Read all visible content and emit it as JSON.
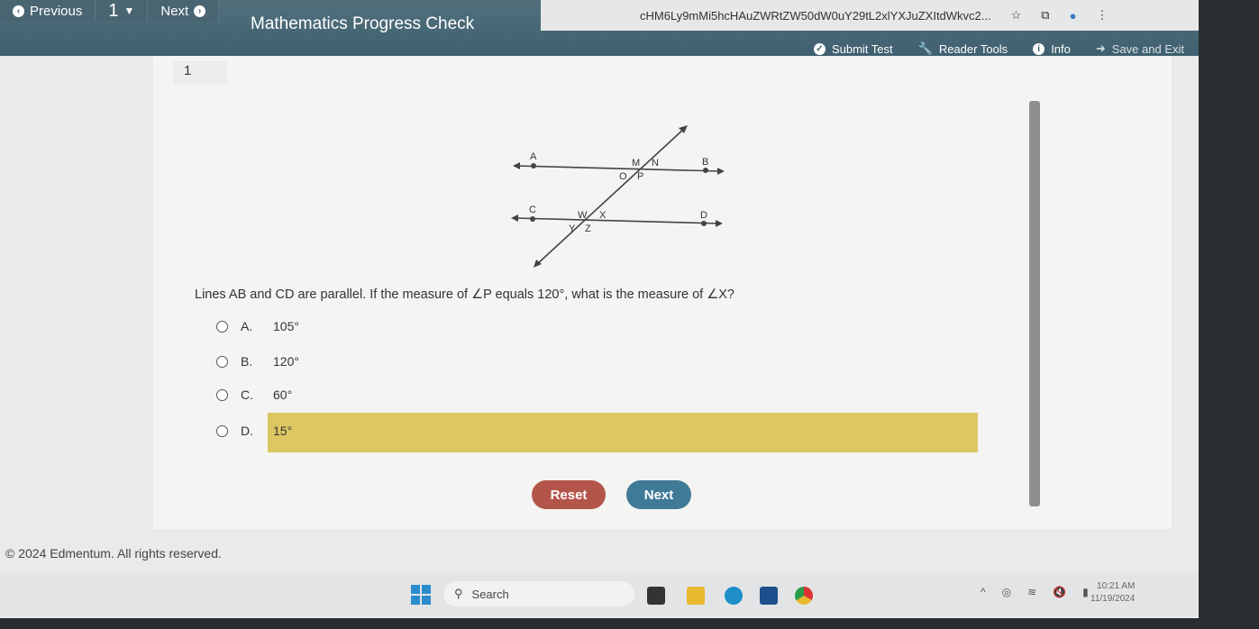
{
  "browser": {
    "url": "cHM6Ly9mMi5hcHAuZWRtZW50dW0uY29tL2xlYXJuZXItdWkvc2...",
    "icons": [
      "star-icon",
      "extension-icon",
      "profile-icon",
      "menu-icon"
    ]
  },
  "header": {
    "previous": "Previous",
    "question_select": "1",
    "next": "Next",
    "title": "Mathematics Progress Check",
    "tools": {
      "submit": "Submit Test",
      "reader": "Reader Tools",
      "info": "Info",
      "save_exit": "Save and Exit"
    }
  },
  "question": {
    "number": "1",
    "diagram_labels": {
      "A": "A",
      "B": "B",
      "C": "C",
      "D": "D",
      "M": "M",
      "N": "N",
      "O": "O",
      "P": "P",
      "W": "W",
      "X": "X",
      "Y": "Y",
      "Z": "Z"
    },
    "text": "Lines AB and CD are parallel. If the measure of ∠P equals 120°, what is the measure of ∠X?",
    "options": [
      {
        "letter": "A.",
        "value": "105°"
      },
      {
        "letter": "B.",
        "value": "120°"
      },
      {
        "letter": "C.",
        "value": "60°"
      },
      {
        "letter": "D.",
        "value": "15°",
        "highlighted": true
      }
    ],
    "highlight_color": "#dec763"
  },
  "buttons": {
    "reset": "Reset",
    "next": "Next"
  },
  "footer": "© 2024 Edmentum. All rights reserved.",
  "taskbar": {
    "search": "Search",
    "time": "10:21 AM",
    "date": "11/19/2024"
  }
}
